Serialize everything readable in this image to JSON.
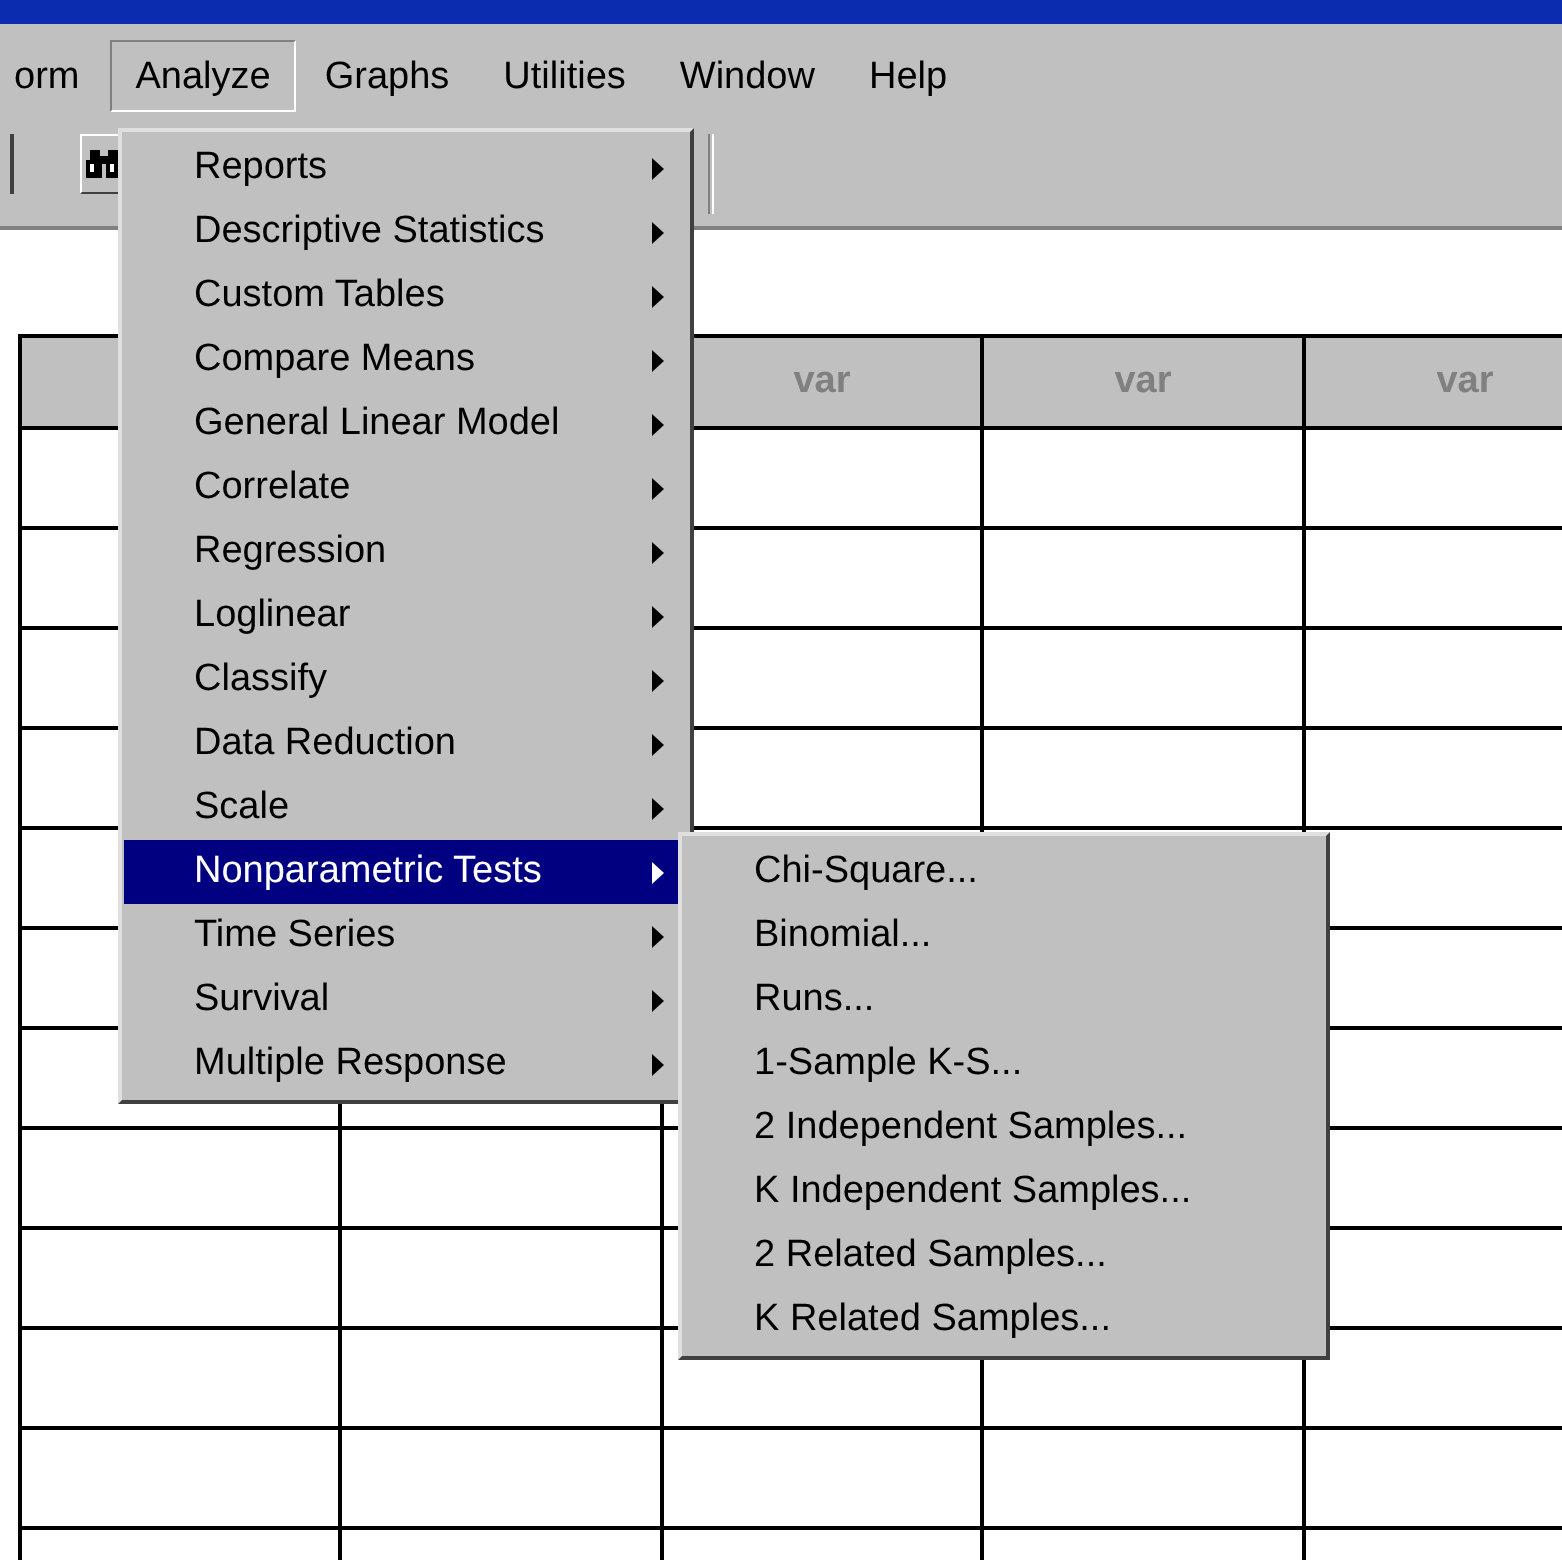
{
  "menu_bar": {
    "items": [
      {
        "label": "orm",
        "selected": false
      },
      {
        "label": "Analyze",
        "selected": true
      },
      {
        "label": "Graphs",
        "selected": false
      },
      {
        "label": "Utilities",
        "selected": false
      },
      {
        "label": "Window",
        "selected": false
      },
      {
        "label": "Help",
        "selected": false
      }
    ]
  },
  "analyze_menu": {
    "items": [
      {
        "label": "Reports",
        "submenu": true,
        "selected": false
      },
      {
        "label": "Descriptive Statistics",
        "submenu": true,
        "selected": false
      },
      {
        "label": "Custom Tables",
        "submenu": true,
        "selected": false
      },
      {
        "label": "Compare Means",
        "submenu": true,
        "selected": false
      },
      {
        "label": "General Linear Model",
        "submenu": true,
        "selected": false
      },
      {
        "label": "Correlate",
        "submenu": true,
        "selected": false
      },
      {
        "label": "Regression",
        "submenu": true,
        "selected": false
      },
      {
        "label": "Loglinear",
        "submenu": true,
        "selected": false
      },
      {
        "label": "Classify",
        "submenu": true,
        "selected": false
      },
      {
        "label": "Data Reduction",
        "submenu": true,
        "selected": false
      },
      {
        "label": "Scale",
        "submenu": true,
        "selected": false
      },
      {
        "label": "Nonparametric Tests",
        "submenu": true,
        "selected": true
      },
      {
        "label": "Time Series",
        "submenu": true,
        "selected": false
      },
      {
        "label": "Survival",
        "submenu": true,
        "selected": false
      },
      {
        "label": "Multiple Response",
        "submenu": true,
        "selected": false
      }
    ]
  },
  "nonparametric_submenu": {
    "items": [
      {
        "label": "Chi-Square...",
        "selected": false
      },
      {
        "label": "Binomial...",
        "selected": false
      },
      {
        "label": "Runs...",
        "selected": false
      },
      {
        "label": "1-Sample K-S...",
        "selected": false
      },
      {
        "label": "2 Independent Samples...",
        "selected": false
      },
      {
        "label": "K Independent Samples...",
        "selected": false
      },
      {
        "label": "2 Related Samples...",
        "selected": false
      },
      {
        "label": "K Related Samples...",
        "selected": false
      }
    ]
  },
  "grid": {
    "column_headers": [
      "var",
      "var",
      "var"
    ]
  }
}
